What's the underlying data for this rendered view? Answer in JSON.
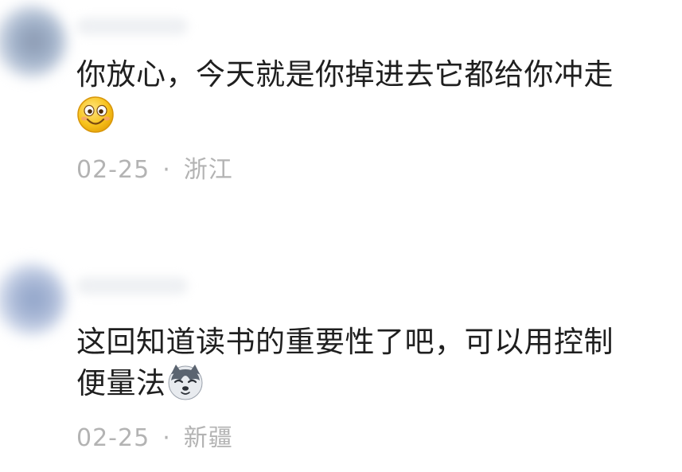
{
  "comments": [
    {
      "text_line1": "你放心，今天就是你掉进去它都给你冲走",
      "emoji": "smiley-face-icon",
      "date": "02-25",
      "separator": "·",
      "location": "浙江"
    },
    {
      "text_line1": "这回知道读书的重要性了吧，可以用控制",
      "text_line2": "便量法",
      "emoji": "husky-dog-icon",
      "date": "02-25",
      "separator": "·",
      "location": "新疆"
    }
  ],
  "colors": {
    "text": "#1f1f1f",
    "meta": "#b3b3b3",
    "background": "#ffffff"
  }
}
